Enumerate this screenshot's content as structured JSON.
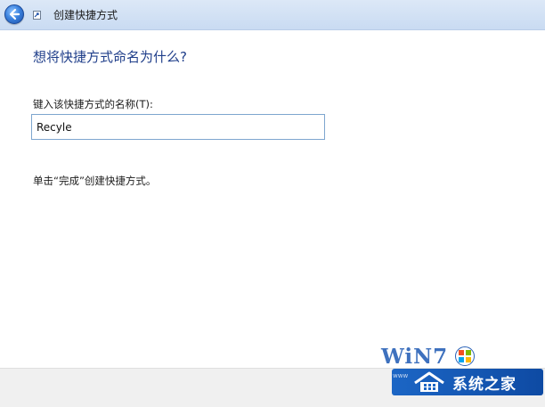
{
  "window": {
    "title": "创建快捷方式"
  },
  "main": {
    "heading": "想将快捷方式命名为什么?",
    "name_label": "键入该快捷方式的名称(T):",
    "name_value": "Recyle",
    "hint": "单击“完成”创建快捷方式。"
  },
  "watermark": {
    "logo_text": "WiN7",
    "site_name": "系统之家",
    "sub_text": "www"
  },
  "colors": {
    "heading": "#1f3e8a",
    "header_bg": "#c9dbf2",
    "input_border": "#7ea6cf",
    "footer_bg": "#f0f0f0",
    "watermark_blue": "#1c66c5"
  },
  "icons": {
    "back": "back-arrow-icon",
    "shortcut": "shortcut-icon",
    "flag": "windows-flag-icon",
    "house": "house-icon"
  }
}
